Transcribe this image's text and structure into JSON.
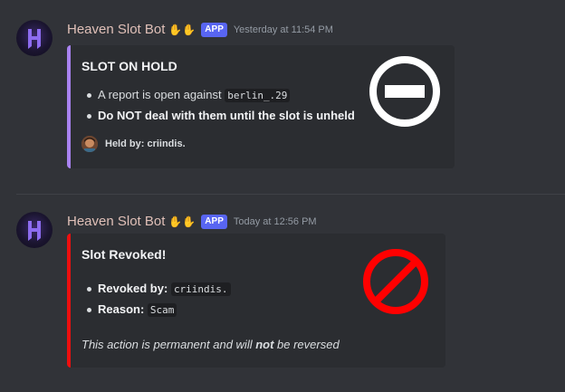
{
  "messages": [
    {
      "username": "Heaven Slot Bot",
      "app_badge": "APP",
      "timestamp": "Yesterday at 11:54 PM",
      "embed": {
        "title": "SLOT ON HOLD",
        "accent": "#a983f2",
        "fields": [
          {
            "prefix": "A report is open against ",
            "code": "berlin_.29"
          },
          {
            "bold": "Do NOT deal with them until the slot is unheld"
          }
        ],
        "footer": "Held by: criindis.",
        "thumbnail_icon": "minus-circle-icon"
      }
    },
    {
      "username": "Heaven Slot Bot",
      "app_badge": "APP",
      "timestamp": "Today at 12:56 PM",
      "embed": {
        "title": "Slot Revoked!",
        "accent": "#ed0f0f",
        "fields": [
          {
            "label": "Revoked by:",
            "code": "criindis."
          },
          {
            "label": "Reason:",
            "code": "Scam"
          }
        ],
        "note_before": "This action is permanent and will ",
        "note_bold": "not",
        "note_after": " be reversed",
        "thumbnail_icon": "prohibited-icon"
      }
    }
  ]
}
